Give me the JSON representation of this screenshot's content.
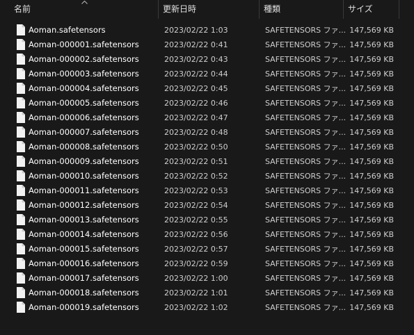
{
  "columns": {
    "name": "名前",
    "date": "更新日時",
    "type": "種類",
    "size": "サイズ"
  },
  "sort": {
    "column": "名前",
    "direction": "ascending",
    "icon": "sort-up-chevron-icon"
  },
  "colors": {
    "background": "#191919",
    "header_divider": "#3a3a3a",
    "text_primary": "#ffffff",
    "text_secondary": "#cfcfcf",
    "file_icon": "#f2f2f2"
  },
  "files": [
    {
      "name": "Aoman.safetensors",
      "date": "2023/02/22 1:03",
      "type": "SAFETENSORS ファ...",
      "size": "147,569 KB",
      "icon": "file-icon"
    },
    {
      "name": "Aoman-000001.safetensors",
      "date": "2023/02/22 0:41",
      "type": "SAFETENSORS ファ...",
      "size": "147,569 KB",
      "icon": "file-icon"
    },
    {
      "name": "Aoman-000002.safetensors",
      "date": "2023/02/22 0:43",
      "type": "SAFETENSORS ファ...",
      "size": "147,569 KB",
      "icon": "file-icon"
    },
    {
      "name": "Aoman-000003.safetensors",
      "date": "2023/02/22 0:44",
      "type": "SAFETENSORS ファ...",
      "size": "147,569 KB",
      "icon": "file-icon"
    },
    {
      "name": "Aoman-000004.safetensors",
      "date": "2023/02/22 0:45",
      "type": "SAFETENSORS ファ...",
      "size": "147,569 KB",
      "icon": "file-icon"
    },
    {
      "name": "Aoman-000005.safetensors",
      "date": "2023/02/22 0:46",
      "type": "SAFETENSORS ファ...",
      "size": "147,569 KB",
      "icon": "file-icon"
    },
    {
      "name": "Aoman-000006.safetensors",
      "date": "2023/02/22 0:47",
      "type": "SAFETENSORS ファ...",
      "size": "147,569 KB",
      "icon": "file-icon"
    },
    {
      "name": "Aoman-000007.safetensors",
      "date": "2023/02/22 0:48",
      "type": "SAFETENSORS ファ...",
      "size": "147,569 KB",
      "icon": "file-icon"
    },
    {
      "name": "Aoman-000008.safetensors",
      "date": "2023/02/22 0:50",
      "type": "SAFETENSORS ファ...",
      "size": "147,569 KB",
      "icon": "file-icon"
    },
    {
      "name": "Aoman-000009.safetensors",
      "date": "2023/02/22 0:51",
      "type": "SAFETENSORS ファ...",
      "size": "147,569 KB",
      "icon": "file-icon"
    },
    {
      "name": "Aoman-000010.safetensors",
      "date": "2023/02/22 0:52",
      "type": "SAFETENSORS ファ...",
      "size": "147,569 KB",
      "icon": "file-icon"
    },
    {
      "name": "Aoman-000011.safetensors",
      "date": "2023/02/22 0:53",
      "type": "SAFETENSORS ファ...",
      "size": "147,569 KB",
      "icon": "file-icon"
    },
    {
      "name": "Aoman-000012.safetensors",
      "date": "2023/02/22 0:54",
      "type": "SAFETENSORS ファ...",
      "size": "147,569 KB",
      "icon": "file-icon"
    },
    {
      "name": "Aoman-000013.safetensors",
      "date": "2023/02/22 0:55",
      "type": "SAFETENSORS ファ...",
      "size": "147,569 KB",
      "icon": "file-icon"
    },
    {
      "name": "Aoman-000014.safetensors",
      "date": "2023/02/22 0:56",
      "type": "SAFETENSORS ファ...",
      "size": "147,569 KB",
      "icon": "file-icon"
    },
    {
      "name": "Aoman-000015.safetensors",
      "date": "2023/02/22 0:57",
      "type": "SAFETENSORS ファ...",
      "size": "147,569 KB",
      "icon": "file-icon"
    },
    {
      "name": "Aoman-000016.safetensors",
      "date": "2023/02/22 0:59",
      "type": "SAFETENSORS ファ...",
      "size": "147,569 KB",
      "icon": "file-icon"
    },
    {
      "name": "Aoman-000017.safetensors",
      "date": "2023/02/22 1:00",
      "type": "SAFETENSORS ファ...",
      "size": "147,569 KB",
      "icon": "file-icon"
    },
    {
      "name": "Aoman-000018.safetensors",
      "date": "2023/02/22 1:01",
      "type": "SAFETENSORS ファ...",
      "size": "147,569 KB",
      "icon": "file-icon"
    },
    {
      "name": "Aoman-000019.safetensors",
      "date": "2023/02/22 1:02",
      "type": "SAFETENSORS ファ...",
      "size": "147,569 KB",
      "icon": "file-icon"
    }
  ]
}
